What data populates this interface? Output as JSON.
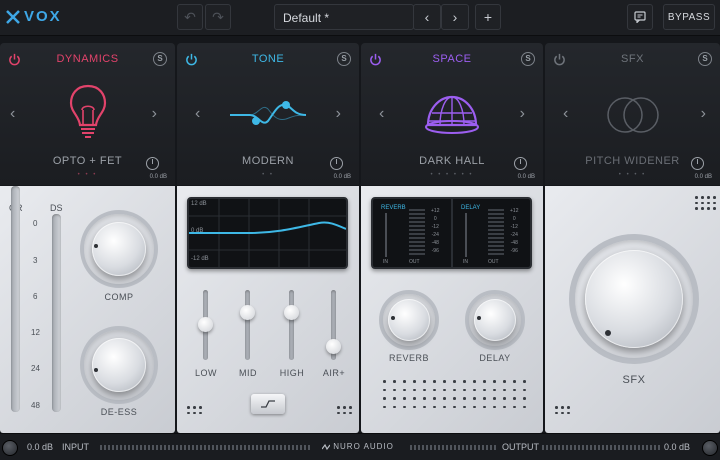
{
  "app": {
    "name": "VOX"
  },
  "toolbar": {
    "undo": "↶",
    "redo": "↷",
    "preset": "Default *",
    "prev": "‹",
    "next": "›",
    "add": "+",
    "bypass": "BYPASS"
  },
  "panels": [
    {
      "title": "DYNAMICS",
      "mode": "OPTO + FET",
      "db": "0.0 dB",
      "accent": "#e2436b",
      "badge": "S",
      "dots": "• • •"
    },
    {
      "title": "TONE",
      "mode": "MODERN",
      "db": "0.0 dB",
      "accent": "#3eb8e6",
      "badge": "S",
      "dots": "• •"
    },
    {
      "title": "SPACE",
      "mode": "DARK HALL",
      "db": "0.0 dB",
      "accent": "#9c5ef0",
      "badge": "S",
      "dots": "• • • • • •"
    },
    {
      "title": "SFX",
      "mode": "PITCH WIDENER",
      "db": "0.0 dB",
      "accent": "#6f747b",
      "badge": "S",
      "dots": "• • • •"
    }
  ],
  "dynamics": {
    "meter_labels": [
      "GR",
      "DS"
    ],
    "scale": [
      "0",
      "3",
      "6",
      "12",
      "24",
      "48"
    ],
    "knobs": [
      "COMP",
      "DE-ESS"
    ]
  },
  "tone": {
    "eq_labels": [
      "12 dB",
      "0 dB",
      "-12 dB"
    ],
    "faders": [
      "LOW",
      "MID",
      "HIGH",
      "AIR+"
    ]
  },
  "space": {
    "reverb_label": "REVERB",
    "delay_label": "DELAY",
    "scale": [
      "+12",
      "0",
      "-12",
      "-24",
      "-48",
      "-96"
    ],
    "in": "IN",
    "out": "OUT",
    "knobs": [
      "REVERB",
      "DELAY"
    ]
  },
  "sfx": {
    "knob": "SFX"
  },
  "footer": {
    "input_db": "0.0 dB",
    "input": "INPUT",
    "brand": "NURO AUDIO",
    "output": "OUTPUT",
    "output_db": "0.0 dB"
  }
}
